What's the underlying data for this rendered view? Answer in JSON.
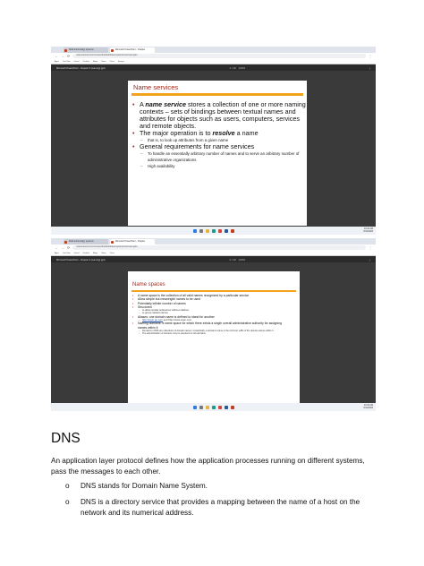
{
  "screenshot1": {
    "tabs": [
      "Multi-terminology systems",
      "Microsoft PowerPoint - Chapter"
    ],
    "url": "www.lectured.com/course/dns/distributed-systems/overview.pptx",
    "bookmarks": [
      "Apps",
      "YouTube",
      "Gmail",
      "Outlook",
      "Maps",
      "News",
      "Drive",
      "Images"
    ],
    "app_title": "Microsoft PowerPoint - Chapter 9 (naming).pptx",
    "page_counter": "1 / 20",
    "zoom": "100%",
    "tray_time": "10:32 AM",
    "tray_date": "5/12/2023",
    "slide": {
      "title": "Name services",
      "bullets": [
        {
          "level": 1,
          "parts": [
            {
              "text": "A ",
              "emph": false
            },
            {
              "text": "name service",
              "emph": true
            },
            {
              "text": " stores a collection of one or more naming contexts – sets of bindings between textual names and attributes for objects such as users, computers, services and remote objects.",
              "emph": false
            }
          ]
        },
        {
          "level": 1,
          "parts": [
            {
              "text": "The major operation is to ",
              "emph": false
            },
            {
              "text": "resolve",
              "emph": true
            },
            {
              "text": " a name",
              "emph": false
            }
          ]
        },
        {
          "level": 2,
          "parts": [
            {
              "text": "that is, to look up attributes from a given name",
              "emph": false
            }
          ]
        },
        {
          "level": 1,
          "parts": [
            {
              "text": "General requirements for name services",
              "emph": false
            }
          ]
        },
        {
          "level": 2,
          "parts": [
            {
              "text": "To handle an essentially arbitrary number of names and to serve an arbitrary number of administrative organizations",
              "emph": false
            }
          ]
        },
        {
          "level": 2,
          "parts": [
            {
              "text": "High availability",
              "emph": false
            }
          ]
        }
      ]
    }
  },
  "screenshot2": {
    "tabs": [
      "Multi-terminology systems",
      "Microsoft PowerPoint - Chapter"
    ],
    "url": "www.lectured.com/course/dns/distributed-systems/overview.pptx",
    "bookmarks": [
      "Apps",
      "YouTube",
      "Gmail",
      "Outlook",
      "Maps",
      "News",
      "Drive"
    ],
    "app_title": "Microsoft PowerPoint - Chapter 9 (naming).pptx",
    "page_counter": "2 / 20",
    "zoom": "100%",
    "tray_time": "10:34 AM",
    "tray_date": "5/12/2023",
    "slide": {
      "title": "Name spaces",
      "bullets": [
        {
          "level": 1,
          "text": "A name space is the collection of all valid names recognized by a particular service"
        },
        {
          "level": 1,
          "text": "Allow simple but meaningful names to be used"
        },
        {
          "level": 1,
          "text": "Potentially infinite number of names"
        },
        {
          "level": 1,
          "text": "Structured"
        },
        {
          "level": 2,
          "text": "to allow similar subnames without clashes"
        },
        {
          "level": 2,
          "text": "to group related names"
        },
        {
          "level": 1,
          "text": "Aliases: one domain name is defined to stand for another"
        },
        {
          "level": 2,
          "parts": [
            {
              "text": "http://espn.go.com",
              "link": true
            },
            {
              "text": " and http://www.espn.com",
              "link": false
            }
          ]
        },
        {
          "level": 1,
          "text": "Naming domains: a name space for which there exists a single overall administrative authority for assigning names within it"
        },
        {
          "level": 3,
          "text": "Domains in DNS are collections of domain names; syntactically, a domain's name is the common suffix of the domain names within it"
        },
        {
          "level": 3,
          "text": "The administration of domains may be devolved to sub-domains"
        }
      ]
    }
  },
  "document": {
    "heading": "DNS",
    "paragraph": "An application layer protocol defines how the application processes running on different systems, pass the messages to each other.",
    "bullet_symbol": "o",
    "bullets": [
      "DNS stands for Domain Name System.",
      "DNS is a directory service that provides a mapping between the name of a host on the network and its numerical address."
    ]
  },
  "colors": {
    "slide_title": "#9c2a1a",
    "slide_rule": "#f3a31b",
    "viewer_bg": "#3a3a3a",
    "taskbar": "#eef1f6"
  }
}
